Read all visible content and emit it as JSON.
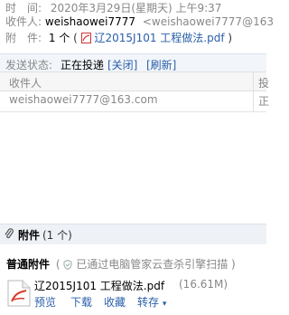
{
  "mail": {
    "time_label": "时　间:",
    "time_value": "2020年3月29日(星期天) 上午9:37",
    "recipient_label": "收件人:",
    "recipient_name": "weishaowei7777",
    "recipient_email": "<weishaowei7777@163",
    "attachment_label": "附　件:",
    "attachment_count": "1 个",
    "attachment_paren_open": "(",
    "attachment_file": "辽2015J101 工程做法.pdf",
    "attachment_paren_close": ")"
  },
  "status": {
    "label": "发送状态:",
    "value": "正在投递",
    "close_link": "[关闭]",
    "refresh_link": "[刷新]"
  },
  "recipients_table": {
    "headers": [
      "收件人",
      "投"
    ],
    "rows": [
      [
        "weishaowei7777@163.com",
        "正"
      ]
    ]
  },
  "attachments": {
    "title": "附件",
    "count": "(1 个)",
    "section_label": "普通附件",
    "scan_note": "已通过电脑管家云查杀引擎扫描",
    "scan_paren_open": "(",
    "scan_paren_close": ")",
    "files": [
      {
        "name": "辽2015J101 工程做法.pdf",
        "size": "(16.61M)",
        "actions": [
          "预览",
          "下载",
          "收藏",
          "转存"
        ]
      }
    ]
  }
}
